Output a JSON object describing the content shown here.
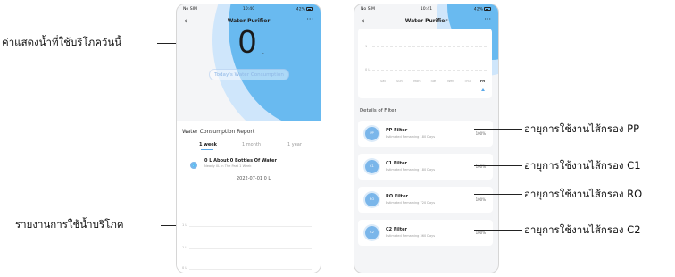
{
  "annotations": {
    "left_today": "ค่าแสดงน้ำที่ใช้บริโภควันนี้",
    "left_report": "รายงานการใช้น้ำบริโภค",
    "right_pp": "อายุการใช้งานไส้กรอง PP",
    "right_c1": "อายุการใช้งานไส้กรอง C1",
    "right_ro": "อายุการใช้งานไส้กรอง RO",
    "right_c2": "อายุการใช้งานไส้กรอง C2"
  },
  "screen1": {
    "status": {
      "carrier": "No SIM",
      "time": "10:40",
      "battery": "42%"
    },
    "nav_title": "Water Purifier",
    "big_value": "0",
    "big_unit": "L",
    "today_label": "Today's Water Consumption",
    "report_title": "Water Consumption Report",
    "tabs": [
      "1 week",
      "1 month",
      "1 year"
    ],
    "tip_main": "0 L About 0 Bottles Of Water",
    "tip_sub": "Nearly 0L in The Past 1 Week",
    "tip_date": "2022-07-01 0 L",
    "y_labels": [
      "1 L",
      "1 L",
      "0 L"
    ],
    "accent": "#7ab6ea"
  },
  "screen2": {
    "status": {
      "carrier": "No SIM",
      "time": "10:41",
      "battery": "42%"
    },
    "nav_title": "Water Purifier",
    "chart_y": [
      "1",
      "0 L"
    ],
    "days": [
      "Sat",
      "Sun",
      "Mon",
      "Tue",
      "Wed",
      "Thu",
      "Fri"
    ],
    "filter_section": "Details of Filter",
    "filters": [
      {
        "code": "PP",
        "name": "PP Filter",
        "sub": "Estimated Remaining 180 Days",
        "pct": "100%"
      },
      {
        "code": "C1",
        "name": "C1 Filter",
        "sub": "Estimated Remaining 180 Days",
        "pct": "100%"
      },
      {
        "code": "RO",
        "name": "RO Filter",
        "sub": "Estimated Remaining 720 Days",
        "pct": "100%"
      },
      {
        "code": "C2",
        "name": "C2 Filter",
        "sub": "Estimated Remaining 360 Days",
        "pct": "100%"
      }
    ]
  }
}
